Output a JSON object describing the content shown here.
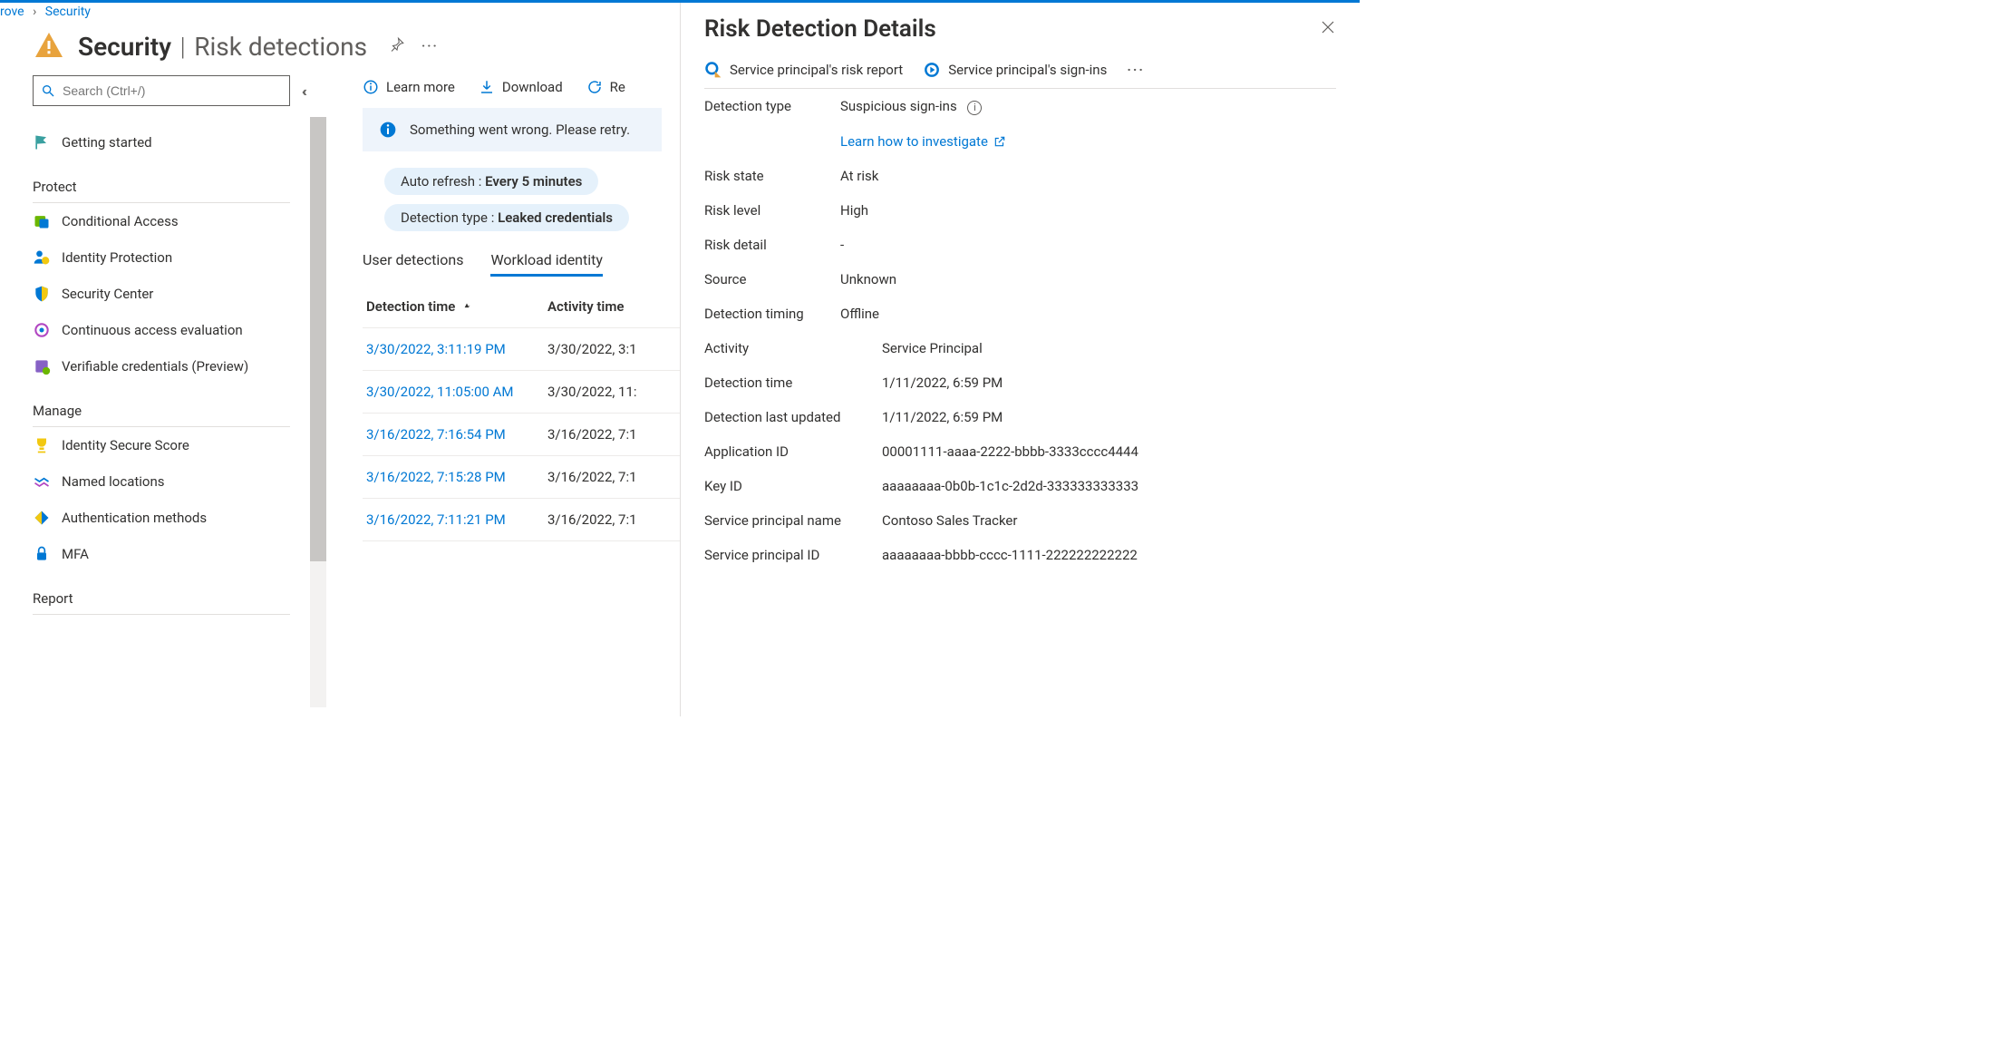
{
  "breadcrumb": {
    "item0": "rove",
    "item1": "Security"
  },
  "header": {
    "title": "Security",
    "subtitle": "Risk detections"
  },
  "search": {
    "placeholder": "Search (Ctrl+/)"
  },
  "sidebar": {
    "getting_started": "Getting started",
    "group_protect": "Protect",
    "protect": {
      "conditional_access": "Conditional Access",
      "identity_protection": "Identity Protection",
      "security_center": "Security Center",
      "continuous_access": "Continuous access evaluation",
      "verifiable_credentials": "Verifiable credentials (Preview)"
    },
    "group_manage": "Manage",
    "manage": {
      "identity_secure_score": "Identity Secure Score",
      "named_locations": "Named locations",
      "authentication_methods": "Authentication methods",
      "mfa": "MFA"
    },
    "group_report": "Report"
  },
  "toolbar": {
    "learn_more": "Learn more",
    "download": "Download",
    "refresh_partial": "Re"
  },
  "error_banner": "Something went wrong. Please retry.",
  "pills": {
    "auto_refresh_label": "Auto refresh : ",
    "auto_refresh_value": "Every 5 minutes",
    "detection_type_label": "Detection type : ",
    "detection_type_value": "Leaked credentials"
  },
  "tabs": {
    "user_detections": "User detections",
    "workload_identity": "Workload identity"
  },
  "grid": {
    "col_detection_time": "Detection time",
    "col_activity_time": "Activity time",
    "rows": [
      {
        "detection": "3/30/2022, 3:11:19 PM",
        "activity": "3/30/2022, 3:1"
      },
      {
        "detection": "3/30/2022, 11:05:00 AM",
        "activity": "3/30/2022, 11:"
      },
      {
        "detection": "3/16/2022, 7:16:54 PM",
        "activity": "3/16/2022, 7:1"
      },
      {
        "detection": "3/16/2022, 7:15:28 PM",
        "activity": "3/16/2022, 7:1"
      },
      {
        "detection": "3/16/2022, 7:11:21 PM",
        "activity": "3/16/2022, 7:1"
      }
    ]
  },
  "details": {
    "title": "Risk Detection Details",
    "action_risk_report": "Service principal's risk report",
    "action_signins": "Service principal's sign-ins",
    "fields": {
      "detection_type_label": "Detection type",
      "detection_type_value": "Suspicious sign-ins",
      "investigate_link": "Learn how to investigate",
      "risk_state_label": "Risk state",
      "risk_state_value": "At risk",
      "risk_level_label": "Risk level",
      "risk_level_value": "High",
      "risk_detail_label": "Risk detail",
      "risk_detail_value": "-",
      "source_label": "Source",
      "source_value": "Unknown",
      "detection_timing_label": "Detection timing",
      "detection_timing_value": "Offline",
      "activity_label": "Activity",
      "activity_value": "Service Principal",
      "detection_time_label": "Detection time",
      "detection_time_value": "1/11/2022, 6:59 PM",
      "detection_last_updated_label": "Detection last updated",
      "detection_last_updated_value": "1/11/2022, 6:59 PM",
      "application_id_label": "Application ID",
      "application_id_value": "00001111-aaaa-2222-bbbb-3333cccc4444",
      "key_id_label": "Key ID",
      "key_id_value": "aaaaaaaa-0b0b-1c1c-2d2d-333333333333",
      "sp_name_label": "Service principal name",
      "sp_name_value": "Contoso Sales Tracker",
      "sp_id_label": "Service principal ID",
      "sp_id_value": "aaaaaaaa-bbbb-cccc-1111-222222222222"
    }
  }
}
